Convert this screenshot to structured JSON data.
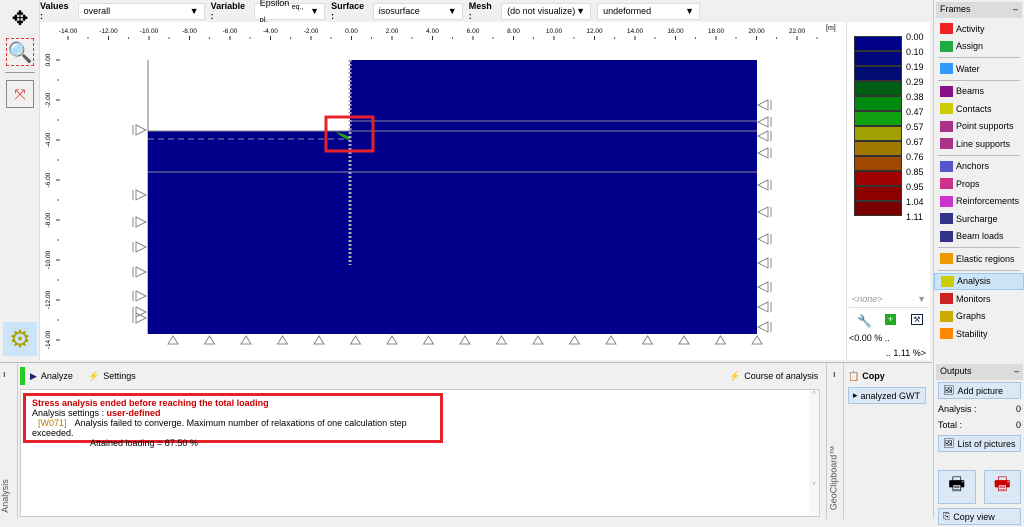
{
  "toolbar": {
    "values_label": "Values :",
    "values": "overall",
    "variable_label": "Variable :",
    "variable": "Epsilon",
    "variable_sub": "eq., pl.",
    "surface_label": "Surface :",
    "surface": "isosurface",
    "mesh_label": "Mesh :",
    "mesh": "(do not visualize)",
    "deform": "undeformed"
  },
  "axes": {
    "x_ticks": [
      "-14.00",
      "-12.00",
      "-10.00",
      "-8.00",
      "-6.00",
      "-4.00",
      "-2.00",
      "0.00",
      "2.00",
      "4.00",
      "6.00",
      "8.00",
      "10.00",
      "12.00",
      "14.00",
      "16.00",
      "18.00",
      "20.00",
      "22.00"
    ],
    "x_unit": "[m]",
    "y_ticks": [
      "0.00",
      "-2.00",
      "-4.00",
      "-6.00",
      "-8.00",
      "-10.00",
      "-12.00",
      "-14.00"
    ]
  },
  "legend": {
    "values": [
      "0.00",
      "0.10",
      "0.19",
      "0.29",
      "0.38",
      "0.47",
      "0.57",
      "0.67",
      "0.76",
      "0.85",
      "0.95",
      "1.04",
      "1.11"
    ],
    "colors": [
      "#00008b",
      "#00067c",
      "#000c72",
      "#005e14",
      "#008a10",
      "#10a010",
      "#a0a000",
      "#a07800",
      "#a04800",
      "#a00000",
      "#8c0000",
      "#780000"
    ],
    "none_select": "<none>",
    "min": "<0.00 % ..",
    "max": ".. 1.11 %>"
  },
  "frames": {
    "title": "Frames",
    "items": [
      {
        "label": "Activity",
        "icon": "activity-icon"
      },
      {
        "label": "Assign",
        "icon": "assign-icon"
      },
      {
        "sep": true
      },
      {
        "label": "Water",
        "icon": "water-icon"
      },
      {
        "sep": true
      },
      {
        "label": "Beams",
        "icon": "beams-icon"
      },
      {
        "label": "Contacts",
        "icon": "contacts-icon"
      },
      {
        "label": "Point supports",
        "icon": "point-supports-icon"
      },
      {
        "label": "Line supports",
        "icon": "line-supports-icon"
      },
      {
        "sep": true
      },
      {
        "label": "Anchors",
        "icon": "anchors-icon"
      },
      {
        "label": "Props",
        "icon": "props-icon"
      },
      {
        "label": "Reinforcements",
        "icon": "reinforcements-icon"
      },
      {
        "label": "Surcharge",
        "icon": "surcharge-icon"
      },
      {
        "label": "Beam loads",
        "icon": "beam-loads-icon"
      },
      {
        "sep": true
      },
      {
        "label": "Elastic regions",
        "icon": "elastic-regions-icon"
      },
      {
        "sep": true
      },
      {
        "label": "Analysis",
        "icon": "analysis-icon",
        "active": true
      },
      {
        "label": "Monitors",
        "icon": "monitors-icon"
      },
      {
        "label": "Graphs",
        "icon": "graphs-icon"
      },
      {
        "label": "Stability",
        "icon": "stability-icon"
      }
    ]
  },
  "outputs": {
    "title": "Outputs",
    "add_picture": "Add picture",
    "analysis_label": "Analysis :",
    "analysis_count": "0",
    "total_label": "Total :",
    "total_count": "0",
    "list": "List of pictures",
    "copy_view": "Copy view"
  },
  "analysis": {
    "side_label": "Analysis",
    "analyze": "Analyze",
    "settings": "Settings",
    "course": "Course of analysis",
    "msg_title": "Stress analysis ended before reaching the total loading",
    "settings_text": "Analysis settings :",
    "settings_value": "user-defined",
    "code": "[W071]",
    "message": "Analysis failed to converge. Maximum number of relaxations of one calculation step exceeded.",
    "attained": "Attained loading = 87.50 %"
  },
  "clipboard": {
    "copy": "Copy",
    "item": "analyzed GWT",
    "side_label": "GeoClipboard™"
  }
}
